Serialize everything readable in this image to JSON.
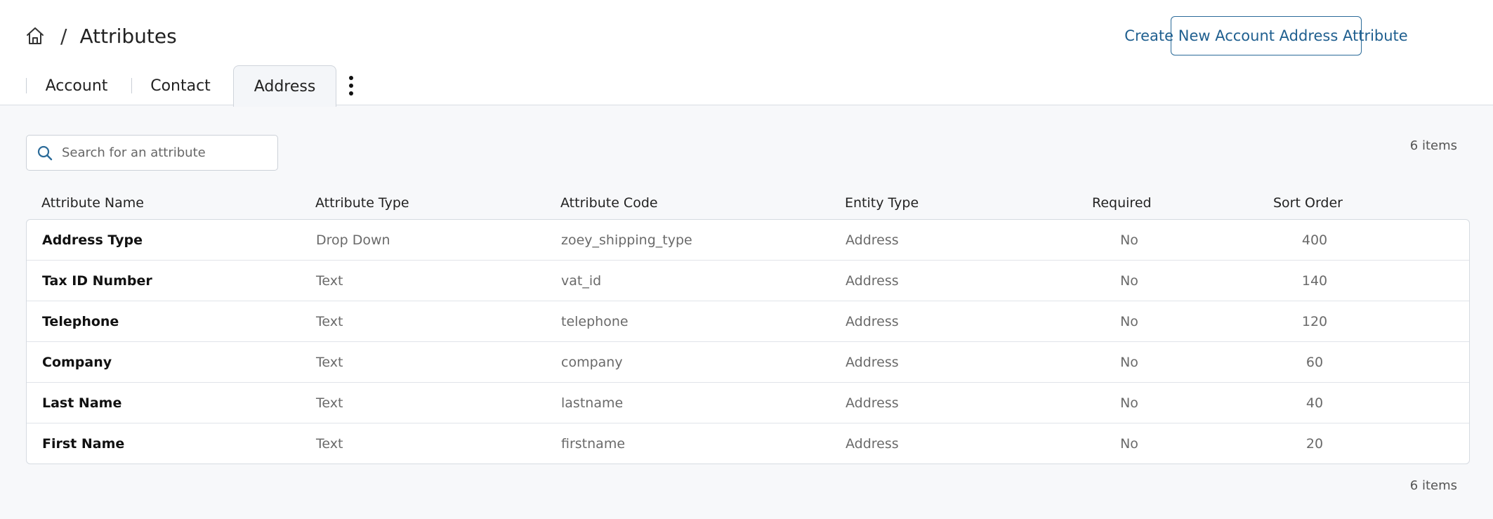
{
  "breadcrumb": {
    "separator": "/",
    "title": "Attributes"
  },
  "header": {
    "create_button_label": "Create New Account Address Attribute"
  },
  "tabs": [
    {
      "label": "Account",
      "active": false
    },
    {
      "label": "Contact",
      "active": false
    },
    {
      "label": "Address",
      "active": true
    }
  ],
  "search": {
    "placeholder": "Search for an attribute",
    "value": ""
  },
  "items_count_top": "6 items",
  "items_count_bottom": "6 items",
  "table": {
    "headers": [
      "Attribute Name",
      "Attribute Type",
      "Attribute Code",
      "Entity Type",
      "Required",
      "Sort Order"
    ],
    "rows": [
      [
        "Address Type",
        "Drop Down",
        "zoey_shipping_type",
        "Address",
        "No",
        "400"
      ],
      [
        "Tax ID Number",
        "Text",
        "vat_id",
        "Address",
        "No",
        "140"
      ],
      [
        "Telephone",
        "Text",
        "telephone",
        "Address",
        "No",
        "120"
      ],
      [
        "Company",
        "Text",
        "company",
        "Address",
        "No",
        "60"
      ],
      [
        "Last Name",
        "Text",
        "lastname",
        "Address",
        "No",
        "40"
      ],
      [
        "First Name",
        "Text",
        "firstname",
        "Address",
        "No",
        "20"
      ]
    ]
  },
  "colors": {
    "accent": "#2b6b99",
    "page_bg": "#f7f8fa",
    "active_tab_bg": "#f4f6f9"
  },
  "icons": {
    "home": "home-icon",
    "search": "search-icon",
    "more": "kebab-icon"
  }
}
